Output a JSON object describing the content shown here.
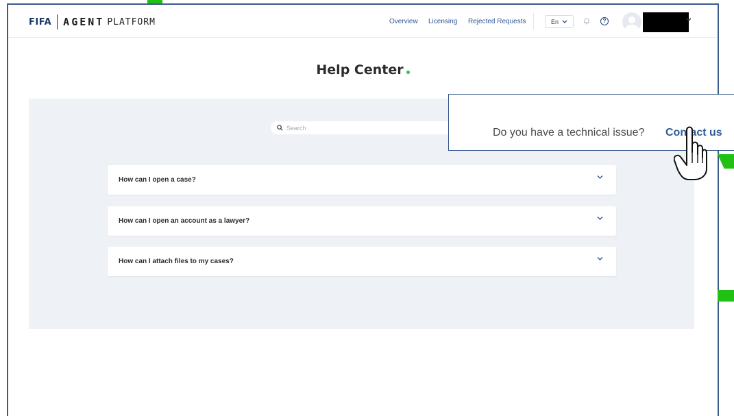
{
  "brand": {
    "fifa": "FIFA",
    "agent": "AGENT",
    "platform": "PLATFORM"
  },
  "nav": {
    "overview": "Overview",
    "licensing": "Licensing",
    "rejected": "Rejected Requests"
  },
  "language": {
    "selected": "En"
  },
  "page": {
    "title": "Help Center"
  },
  "search": {
    "placeholder": "Search"
  },
  "faq": [
    {
      "question": "How can I open a case?"
    },
    {
      "question": "How can I open an account as a lawyer?"
    },
    {
      "question": "How can I attach files to my cases?"
    }
  ],
  "callout": {
    "text": "Do you have a technical issue?",
    "link": "Contact us"
  },
  "icons": {
    "search": "search-icon",
    "bell": "bell-icon",
    "help": "help-icon",
    "avatar": "avatar-icon",
    "chevron": "chevron-down-icon",
    "cursor": "hand-pointer-icon"
  },
  "colors": {
    "brand_navy": "#1b3768",
    "link_blue": "#2e5d9b",
    "accent_green": "#22c55e",
    "panel_bg": "#eef1f5"
  }
}
